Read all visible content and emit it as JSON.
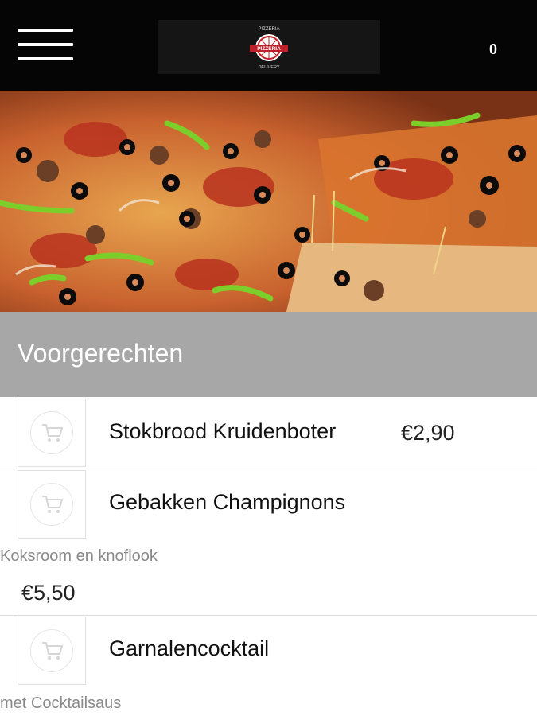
{
  "header": {
    "menu_icon": "hamburger-menu-icon",
    "cart_count": "0"
  },
  "logo": {
    "top_text": "PIZZERIA",
    "main_text": "PIZZERIA",
    "bottom_text": "DELIVERY"
  },
  "section": {
    "title": "Voorgerechten"
  },
  "menu_items": [
    {
      "name": "Stokbrood Kruidenboter",
      "price": "€2,90",
      "description": ""
    },
    {
      "name": "Gebakken Champignons",
      "price": "€5,50",
      "description": "Koksroom en knoflook"
    },
    {
      "name": "Garnalencocktail",
      "price": "",
      "description": "met Cocktailsaus"
    }
  ],
  "colors": {
    "header_bg": "#050505",
    "section_bar": "#a7a7a7",
    "logo_red": "#c0202a"
  }
}
